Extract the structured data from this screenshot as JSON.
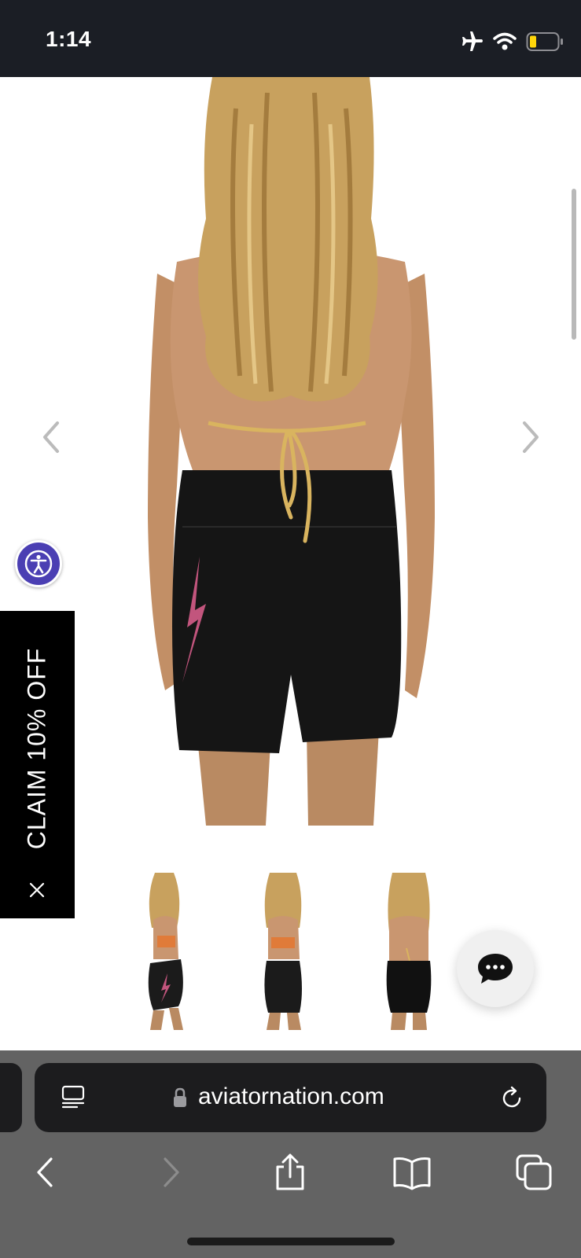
{
  "status_bar": {
    "time": "1:14",
    "icons": [
      "airplane-mode-icon",
      "wifi-icon",
      "battery-low-icon"
    ],
    "battery_color": "#ffd60a"
  },
  "product_gallery": {
    "prev_icon": "chevron-left-icon",
    "next_icon": "chevron-right-icon",
    "thumbnails": [
      "side-view",
      "front-view",
      "back-view"
    ]
  },
  "promo": {
    "claim_label": "CLAIM 10% OFF",
    "close_icon": "close-icon",
    "background": "#000000"
  },
  "accessibility": {
    "icon": "accessibility-icon",
    "color": "#4b3fb3"
  },
  "chat": {
    "icon": "chat-bubble-icon"
  },
  "browser": {
    "url": "aviatornation.com",
    "toolbar_icons": [
      "back-icon",
      "forward-icon",
      "share-icon",
      "bookmarks-icon",
      "tabs-icon"
    ]
  }
}
